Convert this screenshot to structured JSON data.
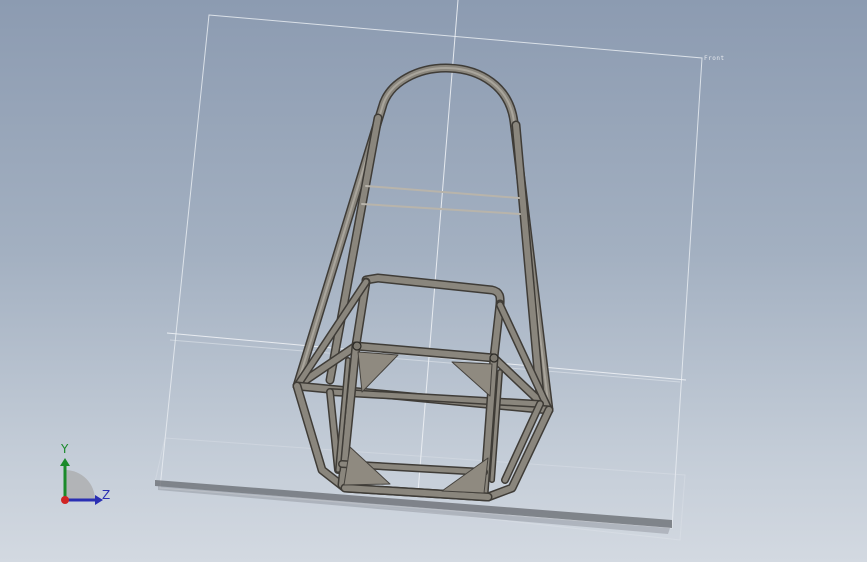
{
  "viewport": {
    "background_top": "#8c9bb1",
    "background_bottom": "#d3d9e1"
  },
  "model": {
    "tube_color": "#7d7970",
    "tube_edge": "#45423d",
    "gusset_color": "#8f8a80",
    "plane_line_color": "#e8ecf1"
  },
  "plane": {
    "tag": "Front"
  },
  "triad": {
    "y_label": "Y",
    "z_label": "Z",
    "x_color": "#d02424",
    "y_color": "#1a8a2a",
    "z_color": "#2a2fb3",
    "icon": "coordinate-triad-icon"
  }
}
